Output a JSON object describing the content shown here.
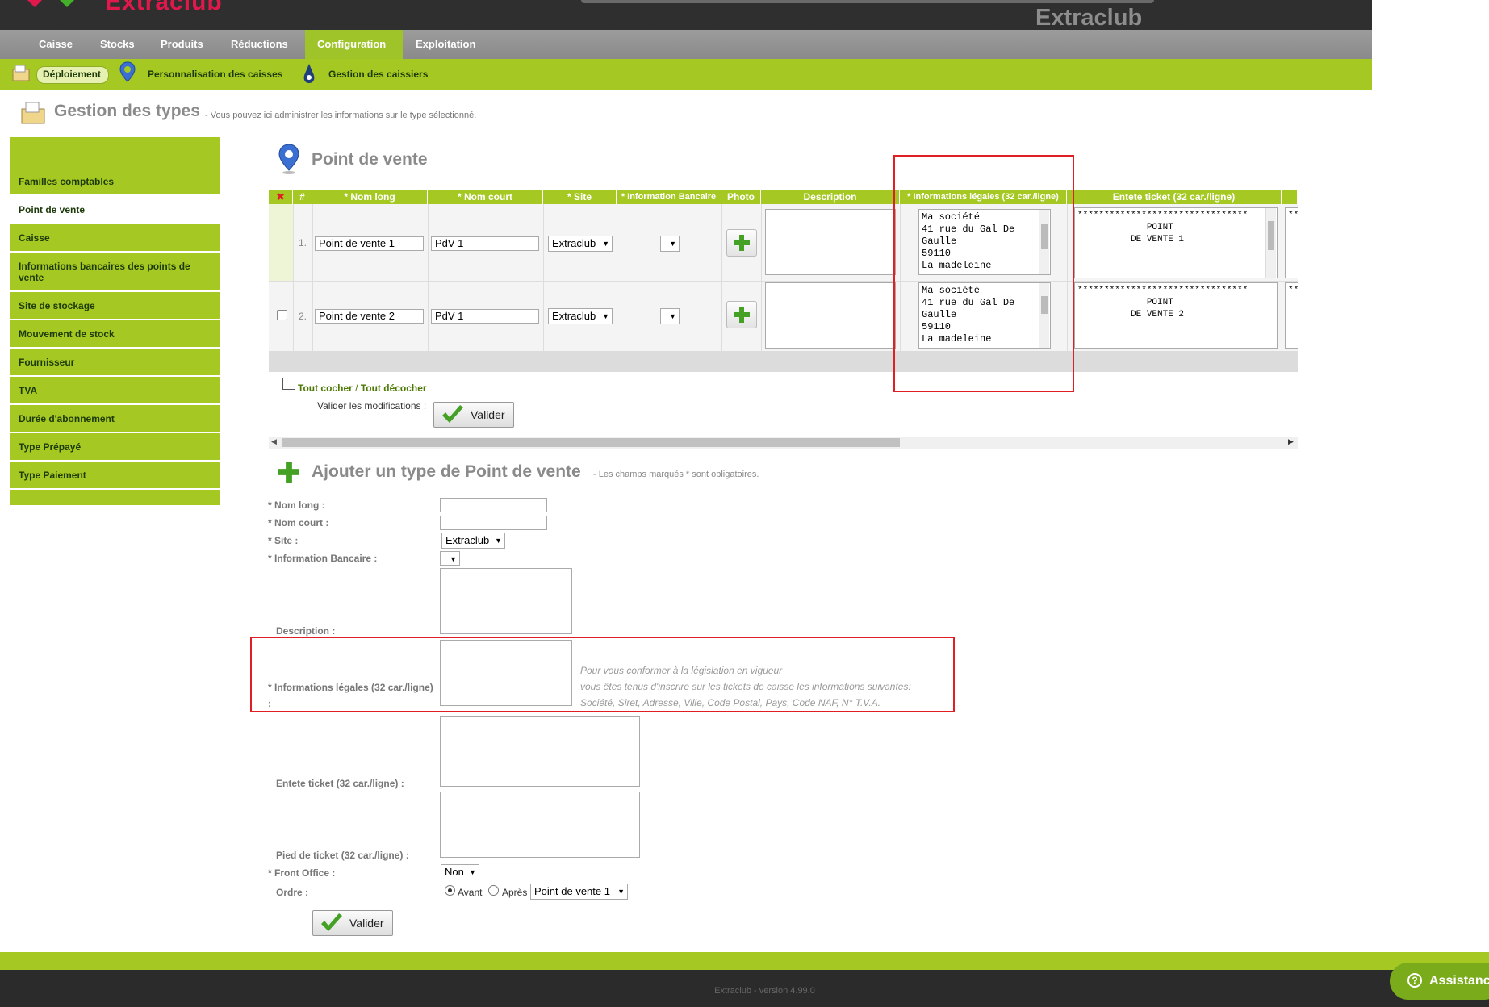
{
  "header": {
    "logo_text": "Extraclub",
    "brand": "Extraclub"
  },
  "main_nav": [
    "Caisse",
    "Stocks",
    "Produits",
    "Réductions",
    "Configuration",
    "Exploitation"
  ],
  "sub_nav": [
    "Déploiement",
    "Personnalisation des caisses",
    "Gestion des caissiers"
  ],
  "page": {
    "title": "Gestion des types",
    "subtitle": "- Vous pouvez ici administrer les informations sur le type sélectionné."
  },
  "sidebar": {
    "items": [
      "Familles comptables",
      "Point de vente",
      "Caisse",
      "Informations bancaires des points de vente",
      "Site de stockage",
      "Mouvement de stock",
      "Fournisseur",
      "TVA",
      "Durée d'abonnement",
      "Type Prépayé",
      "Type Paiement"
    ],
    "active": "Point de vente"
  },
  "grid": {
    "section_title": "Point de vente",
    "columns": [
      "#",
      "* Nom long",
      "* Nom court",
      "* Site",
      "* Information Bancaire",
      "Photo",
      "Description",
      "* Informations légales (32 car./ligne)",
      "Entete ticket (32 car./ligne)"
    ],
    "rows": [
      {
        "index": "1.",
        "nom_long": "Point de vente 1",
        "nom_court": "PdV 1",
        "site": "Extraclub",
        "info_bancaire": "",
        "description": "",
        "info_legales": "Ma société\n41 rue du Gal De\nGaulle\n59110\nLa madeleine",
        "entete": "********************************\n             POINT\n          DE VENTE 1"
      },
      {
        "index": "2.",
        "nom_long": "Point de vente 2",
        "nom_court": "PdV 1",
        "site": "Extraclub",
        "info_bancaire": "",
        "description": "",
        "info_legales": "Ma société\n41 rue du Gal De\nGaulle\n59110\nLa madeleine",
        "entete": "********************************\n             POINT\n          DE VENTE 2"
      }
    ],
    "next_col_peek": "**",
    "check_all": "Tout cocher",
    "separator": "/",
    "uncheck_all": "Tout décocher",
    "validate_label": "Valider les modifications :",
    "validate_button": "Valider"
  },
  "add_form": {
    "title": "Ajouter un type de Point de vente",
    "subtitle": "- Les champs marqués * sont obligatoires.",
    "labels": {
      "nom_long": "* Nom long :",
      "nom_court": "* Nom court :",
      "site": "* Site :",
      "info_bancaire": "* Information Bancaire :",
      "description": "Description :",
      "info_legales": "* Informations légales (32 car./ligne)",
      "info_legales_colon": ":",
      "entete": "Entete ticket (32 car./ligne) :",
      "pied": "Pied de ticket (32 car./ligne) :",
      "front_office": "* Front Office :",
      "ordre": "Ordre :"
    },
    "site_value": "Extraclub",
    "info_bancaire_value": "",
    "front_office_value": "Non",
    "ordre_avant": "Avant",
    "ordre_apres": "Après",
    "ordre_ref": "Point de vente 1",
    "hint_lines": [
      "Pour vous conformer à la législation en vigueur",
      "vous êtes tenus d'inscrire sur les tickets de caisse les informations suivantes:",
      "Société, Siret, Adresse, Ville, Code Postal, Pays, Code NAF, N° T.V.A."
    ],
    "submit": "Valider"
  },
  "footer": {
    "version": "Extraclub - version 4.99.0",
    "assistance": "Assistance"
  },
  "colors": {
    "accent_green": "#a5c823",
    "highlight_red": "#e01f25",
    "header_dark": "#2f2f2f"
  }
}
